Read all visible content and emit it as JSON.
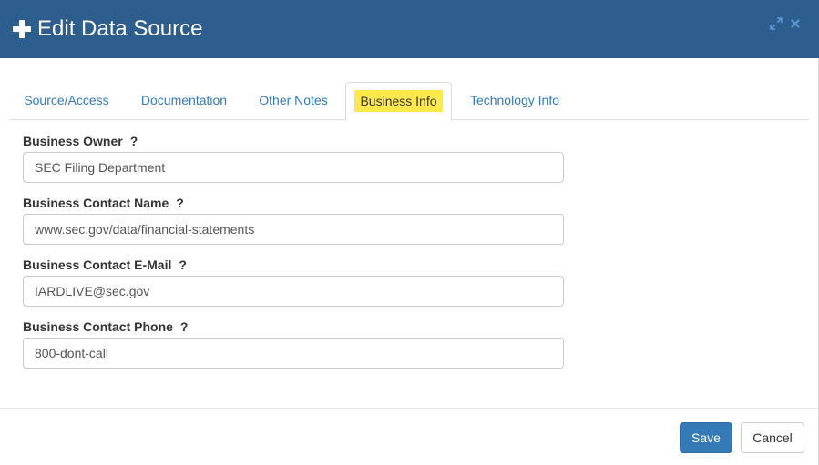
{
  "dialog": {
    "title": "Edit Data Source",
    "header_icon": "plus-icon",
    "tools": [
      "expand-icon",
      "close-icon"
    ],
    "header_color": "#2e5e8e"
  },
  "tabs": [
    {
      "label": "Source/Access",
      "active": false
    },
    {
      "label": "Documentation",
      "active": false
    },
    {
      "label": "Other Notes",
      "active": false
    },
    {
      "label": "Business Info",
      "active": true
    },
    {
      "label": "Technology Info",
      "active": false
    }
  ],
  "form": {
    "fields": [
      {
        "label": "Business Owner",
        "help": "?",
        "value": "SEC Filing Department"
      },
      {
        "label": "Business Contact Name",
        "help": "?",
        "value": "www.sec.gov/data/financial-statements"
      },
      {
        "label": "Business Contact E-Mail",
        "help": "?",
        "value": "IARDLIVE@sec.gov"
      },
      {
        "label": "Business Contact Phone",
        "help": "?",
        "value": "800-dont-call"
      }
    ]
  },
  "footer": {
    "save_label": "Save",
    "cancel_label": "Cancel"
  },
  "colors": {
    "accent": "#337ab7",
    "highlight": "#ffe94a"
  }
}
